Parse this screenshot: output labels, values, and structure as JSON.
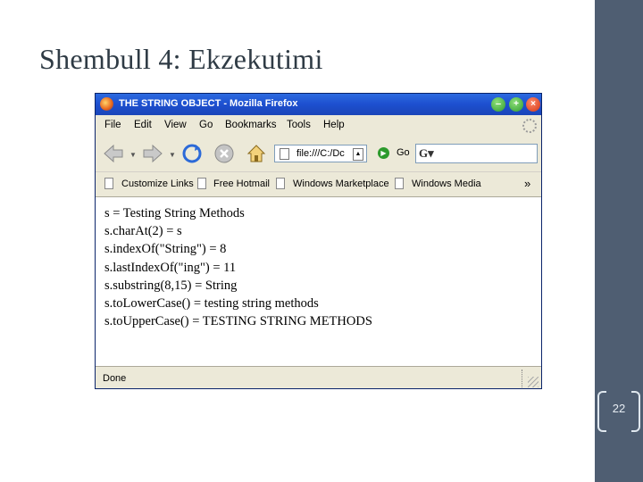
{
  "slide": {
    "title": "Shembull 4: Ekzekutimi",
    "page_number": "22"
  },
  "browser": {
    "window_title": "THE STRING OBJECT - Mozilla Firefox",
    "menu": [
      "File",
      "Edit",
      "View",
      "Go",
      "Bookmarks",
      "Tools",
      "Help"
    ],
    "address": "file:///C:/Dc",
    "go_label": "Go",
    "bookmarks": [
      "Customize Links",
      "Free Hotmail",
      "Windows Marketplace",
      "Windows Media"
    ],
    "bookmarks_more": "»",
    "content_lines": [
      "s = Testing String Methods",
      "s.charAt(2) = s",
      "s.indexOf(\"String\") = 8",
      "s.lastIndexOf(\"ing\") = 11",
      "s.substring(8,15) = String",
      "s.toLowerCase() = testing string methods",
      "s.toUpperCase() = TESTING STRING METHODS"
    ],
    "status": "Done"
  },
  "colors": {
    "sidebar": "#4f5e72",
    "titlebar": "#1d4fcf",
    "chrome": "#ece9d8"
  }
}
